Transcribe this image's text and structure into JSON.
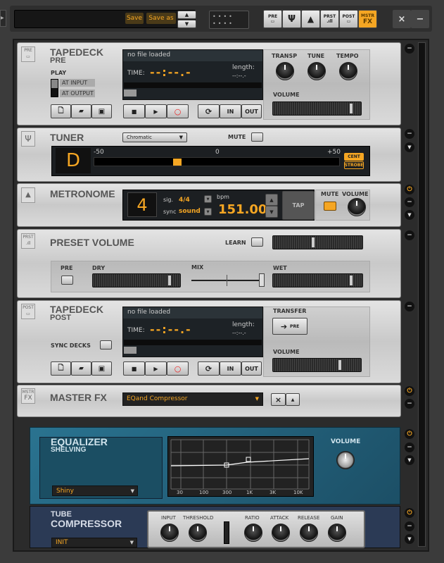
{
  "topbar": {
    "save": "Save",
    "save_as": "Save as",
    "up": "▲",
    "down": "▼",
    "modules": [
      {
        "top": "PRE",
        "icon": "tape"
      },
      {
        "icon": "tuner"
      },
      {
        "icon": "metronome"
      },
      {
        "top": "PRST",
        "icon": "volume"
      },
      {
        "top": "POST",
        "icon": "tape"
      },
      {
        "top": "MSTR",
        "bottom": "FX",
        "active": true
      }
    ],
    "close": "×",
    "minimize": "−"
  },
  "colors": {
    "accent": "#f5a623",
    "eq_panel": "#1f5f78",
    "comp_panel": "#2b3a55"
  },
  "tapedeck_pre": {
    "badge": "PRE",
    "title": "TAPEDECK",
    "subtitle": "PRE",
    "play_label": "PLAY",
    "at_input": "AT INPUT",
    "at_output": "AT OUTPUT",
    "file": "no file loaded",
    "time_label": "TIME:",
    "time": "--:--.-",
    "length_label": "length:",
    "length": "--:--.-",
    "in": "IN",
    "out": "OUT",
    "knobs": [
      "TRANSP",
      "TUNE",
      "TEMPO"
    ],
    "volume_label": "VOLUME",
    "volume": 0.95
  },
  "tuner": {
    "title": "TUNER",
    "mode": "Chromatic",
    "mute": "MUTE",
    "note": "D",
    "scale_min": "-50",
    "scale_mid": "0",
    "scale_max": "+50",
    "cent": "CENT",
    "strobe": "STROBE",
    "deviation": -17
  },
  "metronome": {
    "title": "METRONOME",
    "beat": "4",
    "sig_label": "sig.",
    "sig": "4/4",
    "sync_label": "sync",
    "sync": "sound",
    "bpm_label": "bpm",
    "bpm": "151.00",
    "tap": "TAP",
    "mute": "MUTE",
    "volume": "VOLUME"
  },
  "preset_volume": {
    "badge": "PRST",
    "title": "PRESET VOLUME",
    "learn": "LEARN",
    "pre": "PRE",
    "dry": "DRY",
    "mix": "MIX",
    "wet": "WET",
    "level": 0.45,
    "dry_level": 0.95,
    "mix_level": 1.0,
    "wet_level": 0.95
  },
  "tapedeck_post": {
    "badge": "POST",
    "title": "TAPEDECK",
    "subtitle": "POST",
    "sync_decks": "SYNC DECKS",
    "file": "no file loaded",
    "time_label": "TIME:",
    "time": "--:--.-",
    "length_label": "length:",
    "length": "--:--.-",
    "in": "IN",
    "out": "OUT",
    "transfer": "TRANSFER",
    "transfer_pre": "PRE",
    "volume_label": "VOLUME",
    "volume": 0.75
  },
  "master_fx": {
    "badge_top": "MSTR",
    "badge_bottom": "FX",
    "title": "MASTER FX",
    "preset": "EQand Compressor",
    "close": "×",
    "up": "▲"
  },
  "equalizer": {
    "title": "EQUALIZER",
    "subtitle": "SHELVING",
    "preset": "Shiny",
    "volume": "VOLUME",
    "freq_ticks": [
      "30",
      "100",
      "300",
      "1K",
      "3K",
      "10K"
    ]
  },
  "compressor": {
    "title1": "TUBE",
    "title2": "COMPRESSOR",
    "preset": "INIT",
    "knobs": [
      "INPUT",
      "THRESHOLD",
      "RATIO",
      "ATTACK",
      "RELEASE",
      "GAIN"
    ]
  }
}
